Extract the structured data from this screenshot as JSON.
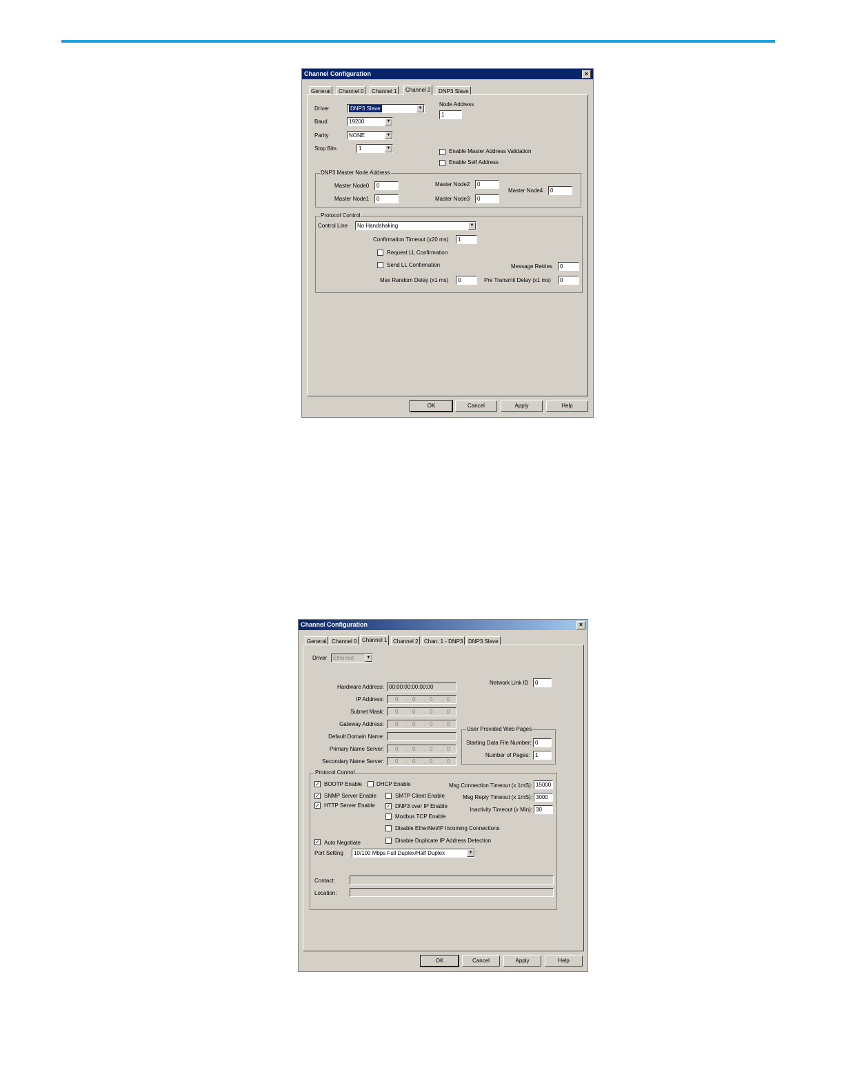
{
  "dialog1": {
    "title": "Channel Configuration",
    "tabs": [
      "General",
      "Channel 0",
      "Channel 1",
      "Channel 2",
      "DNP3 Slave"
    ],
    "active_tab": "Channel 2",
    "driver_label": "Driver",
    "driver_value": "DNP3 Slave",
    "baud_label": "Baud",
    "baud_value": "19200",
    "parity_label": "Parity",
    "parity_value": "NONE",
    "stop_bits_label": "Stop Bits",
    "stop_bits_value": "1",
    "node_address_label": "Node Address",
    "node_address_value": "1",
    "enable_master_validation": "Enable Master Address Validation",
    "enable_self_address": "Enable Self Address",
    "master_group_title": "DNP3 Master Node Address",
    "master_node0_label": "Master Node0",
    "master_node0_value": "0",
    "master_node1_label": "Master Node1",
    "master_node1_value": "0",
    "master_node2_label": "Master Node2",
    "master_node2_value": "0",
    "master_node3_label": "Master Node3",
    "master_node3_value": "0",
    "master_node4_label": "Master Node4",
    "master_node4_value": "0",
    "protocol_group_title": "Protocol Control",
    "control_line_label": "Control Line",
    "control_line_value": "No Handshaking",
    "confirmation_timeout_label": "Confirmation Timeout (x20 ms)",
    "confirmation_timeout_value": "1",
    "request_ll_confirmation": "Request LL Confirmation",
    "send_ll_confirmation": "Send LL Confirmation",
    "message_retries_label": "Message Retries",
    "message_retries_value": "0",
    "max_random_delay_label": "Max Random Delay (x1 ms)",
    "max_random_delay_value": "0",
    "pre_transmit_delay_label": "Pre Transmit Delay (x1 ms)",
    "pre_transmit_delay_value": "0",
    "buttons": {
      "ok": "OK",
      "cancel": "Cancel",
      "apply": "Apply",
      "help": "Help"
    }
  },
  "dialog2": {
    "title": "Channel Configuration",
    "tabs": [
      "General",
      "Channel 0",
      "Channel 1",
      "Channel 2",
      "Chan. 1 - DNP3",
      "DNP3 Slave"
    ],
    "active_tab": "Channel 1",
    "driver_label": "Driver",
    "driver_value": "Ethernet",
    "hardware_address_label": "Hardware Address:",
    "hardware_address_value": "00:00:00:00:00:00",
    "ip_address_label": "IP Address:",
    "subnet_mask_label": "Subnet Mask:",
    "gateway_address_label": "Gateway Address:",
    "default_domain_label": "Default Domain Name:",
    "primary_name_server_label": "Primary Name Server:",
    "secondary_name_server_label": "Secondary Name Server:",
    "ip_octet": "0",
    "network_link_id_label": "Network Link ID",
    "network_link_id_value": "0",
    "web_group_title": "User Provided Web Pages",
    "starting_file_label": "Starting Data File Number:",
    "starting_file_value": "0",
    "number_pages_label": "Number of Pages:",
    "number_pages_value": "1",
    "protocol_group_title": "Protocol Control",
    "bootp": "BOOTP Enable",
    "dhcp": "DHCP Enable",
    "snmp": "SNMP Server Enable",
    "smtp": "SMTP Client Enable",
    "http": "HTTP Server Enable",
    "dnp3_ip": "DNP3 over IP Enable",
    "modbus_tcp": "Modbus TCP Enable",
    "disable_ethernetip": "Disable EtherNet/IP Incoming Connections",
    "disable_dup_ip": "Disable Duplicate IP Address Detection",
    "auto_negotiate": "Auto Negotiate",
    "check_mark": "✓",
    "msg_conn_timeout_label": "Msg Connection Timeout (x 1mS):",
    "msg_conn_timeout_value": "15000",
    "msg_reply_timeout_label": "Msg Reply Timeout (x 1mS):",
    "msg_reply_timeout_value": "3000",
    "inactivity_timeout_label": "Inactivity Timeout (x Min):",
    "inactivity_timeout_value": "30",
    "port_setting_label": "Port Setting",
    "port_setting_value": "10/100 Mbps Full Duplex/Half Duplex",
    "contact_label": "Contact:",
    "location_label": "Location:",
    "buttons": {
      "ok": "OK",
      "cancel": "Cancel",
      "apply": "Apply",
      "help": "Help"
    }
  }
}
